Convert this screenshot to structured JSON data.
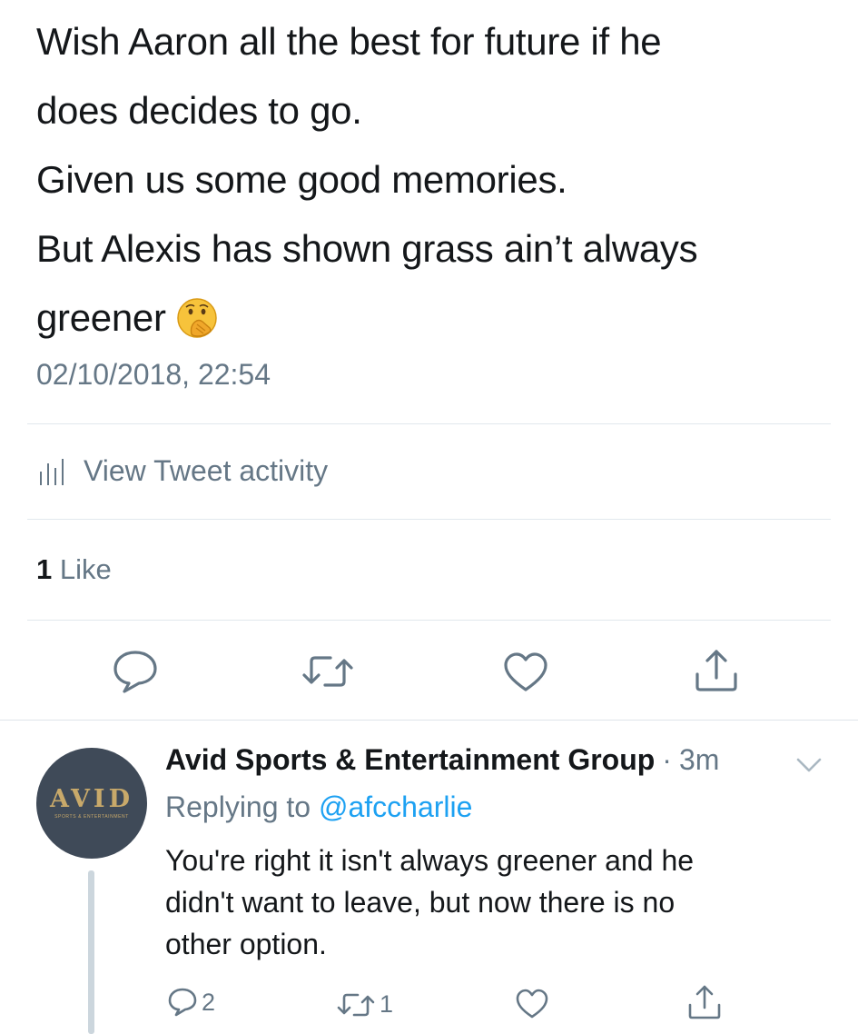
{
  "tweet": {
    "lines": [
      "Wish Aaron all the best for future if he",
      "does decides to go.",
      "Given us some good memories.",
      "But Alexis has shown grass ain’t always",
      "greener"
    ],
    "emoji": "face-with-hand-over-mouth",
    "timestamp": "02/10/2018, 22:54",
    "activity_label": "View Tweet activity",
    "likes_count": "1",
    "likes_label": "Like"
  },
  "reply": {
    "author": "Avid Sports & Entertainment Group",
    "separator": "·",
    "age": "3m",
    "avatar": {
      "word": "AVID",
      "subtitle": "SPORTS & ENTERTAINMENT"
    },
    "replying_prefix": "Replying to",
    "replying_handle": "@afccharlie",
    "lines": [
      "You're right it isn't always greener and he",
      "didn't want to leave, but now there is no",
      "other option."
    ],
    "reply_count": "2",
    "retweet_count": "1"
  },
  "colors": {
    "text": "#14171a",
    "muted": "#657786",
    "link": "#1da1f2",
    "divider": "#e1e8ed"
  }
}
